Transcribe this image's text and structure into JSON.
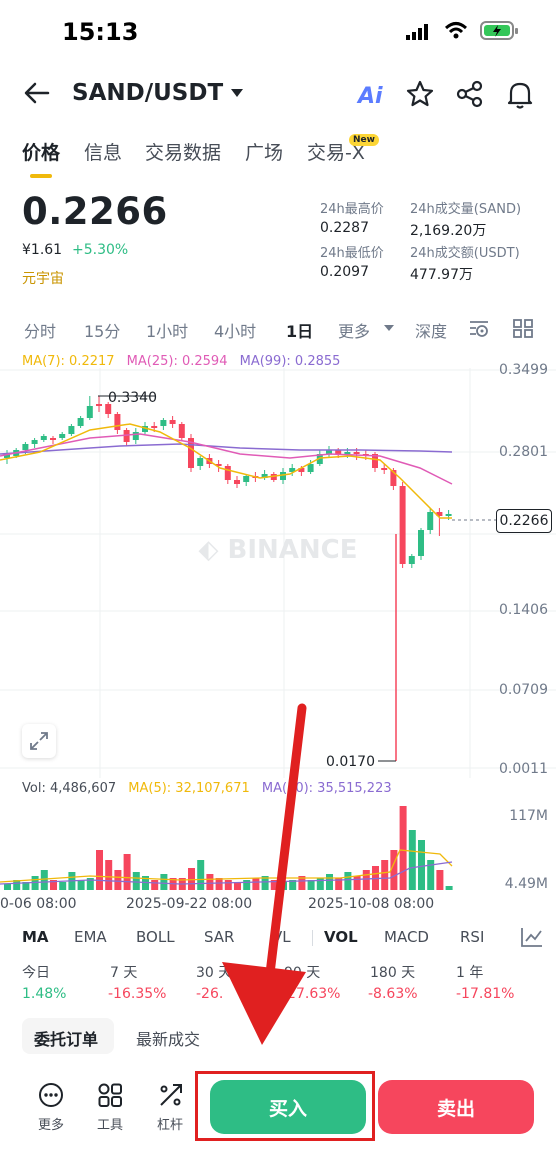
{
  "status_bar": {
    "time": "15:13"
  },
  "header": {
    "pair": "SAND/USDT",
    "ai_label": "Ai"
  },
  "tabs": [
    "价格",
    "信息",
    "交易数据",
    "广场",
    "交易-X"
  ],
  "new_badge": "New",
  "price": {
    "last": "0.2266",
    "cny": "¥1.61",
    "change": "+5.30%",
    "category": "元宇宙"
  },
  "stats": {
    "high_label": "24h最高价",
    "high": "0.2287",
    "vol_base_label": "24h成交量(SAND)",
    "vol_base": "2,169.20万",
    "low_label": "24h最低价",
    "low": "0.2097",
    "vol_quote_label": "24h成交额(USDT)",
    "vol_quote": "477.97万"
  },
  "intervals": [
    "分时",
    "15分",
    "1小时",
    "4小时",
    "1日",
    "更多",
    "深度"
  ],
  "ma": {
    "ma7": "MA(7): 0.2217",
    "ma25": "MA(25): 0.2594",
    "ma99": "MA(99): 0.2855"
  },
  "price_axis": [
    "0.3499",
    "0.2801",
    "0.1406",
    "0.0709",
    "0.0011"
  ],
  "current_price_tag": "0.2266",
  "high_marker": "0.3340",
  "low_marker": "0.0170",
  "watermark": "BINANCE",
  "volume": {
    "vol": "Vol: 4,486,607",
    "ma5": "MA(5): 32,107,671",
    "ma10": "MA(10): 35,515,223",
    "axis_top": "117M",
    "axis_bottom": "4.49M"
  },
  "dates": [
    "0-06 08:00",
    "2025-09-22 08:00",
    "2025-10-08 08:00"
  ],
  "indicators": [
    "MA",
    "EMA",
    "BOLL",
    "SAR",
    "VL",
    "VOL",
    "MACD",
    "RSI"
  ],
  "performance": {
    "labels": [
      "今日",
      "7 天",
      "30 天",
      "90 天",
      "180 天",
      "1 年"
    ],
    "values": [
      "1.48%",
      "-16.35%",
      "-26.",
      "-27.63%",
      "-8.63%",
      "-17.81%"
    ]
  },
  "bottom_tabs": [
    "委托订单",
    "最新成交"
  ],
  "tools": [
    "更多",
    "工具",
    "杠杆"
  ],
  "actions": {
    "buy": "买入",
    "sell": "卖出"
  },
  "colors": {
    "up": "#2ebd85",
    "down": "#f6465d",
    "accent": "#f0b90b",
    "ma7": "#f0b90b",
    "ma25": "#e05bb6",
    "ma99": "#8a6bd1"
  }
}
